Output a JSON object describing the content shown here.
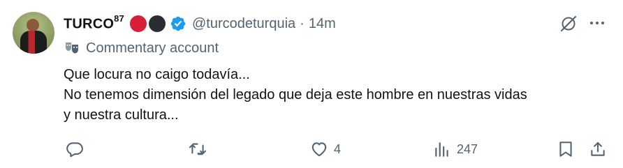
{
  "author": {
    "display_name": "TURCO",
    "display_name_superscript": "87",
    "handle": "@turcodeturquia",
    "separator": "·",
    "time": "14m"
  },
  "label": {
    "text": "Commentary account"
  },
  "tweet": {
    "lines": [
      "Que locura no caigo todavía...",
      "No tenemos dimensión del legado que deja este hombre en nuestras vidas",
      "y nuestra cultura..."
    ]
  },
  "actions": {
    "reply_count": "",
    "retweet_count": "",
    "like_count": "4",
    "views_count": "247"
  },
  "icons": {
    "verified": "verified-badge-icon",
    "grok": "grok-icon",
    "more": "more-icon",
    "commentary": "mask-icon",
    "reply": "reply-icon",
    "retweet": "retweet-icon",
    "like": "heart-icon",
    "views": "views-icon",
    "bookmark": "bookmark-icon",
    "share": "share-icon"
  },
  "colors": {
    "verified_blue": "#1d9bf0",
    "muted": "#536471",
    "text": "#0f1419",
    "emoji_red": "#d81f3a",
    "emoji_black": "#2a2d33"
  }
}
